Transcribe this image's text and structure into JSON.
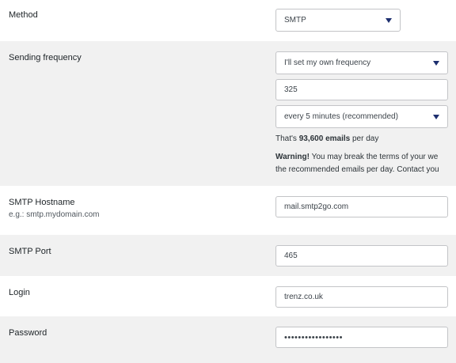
{
  "method": {
    "label": "Method",
    "selected": "SMTP"
  },
  "sending_frequency": {
    "label": "Sending frequency",
    "frequency_mode": "I'll set my own frequency",
    "emails_count": "325",
    "interval": "every 5 minutes (recommended)",
    "summary_prefix": "That's",
    "summary_value": "93,600 emails",
    "summary_suffix": "per day",
    "warning_bold": "Warning!",
    "warning_line1": "You may break the terms of your we",
    "warning_line2": "the recommended emails per day. Contact you"
  },
  "smtp_hostname": {
    "label": "SMTP Hostname",
    "description": "e.g.: smtp.mydomain.com",
    "value": "mail.smtp2go.com"
  },
  "smtp_port": {
    "label": "SMTP Port",
    "value": "465"
  },
  "login": {
    "label": "Login",
    "value": "trenz.co.uk"
  },
  "password": {
    "label": "Password",
    "value": "•••••••••••••••••"
  },
  "colors": {
    "row_alt": "#f1f1f1",
    "border": "#c3c4c7",
    "caret": "#1d2f6f"
  }
}
